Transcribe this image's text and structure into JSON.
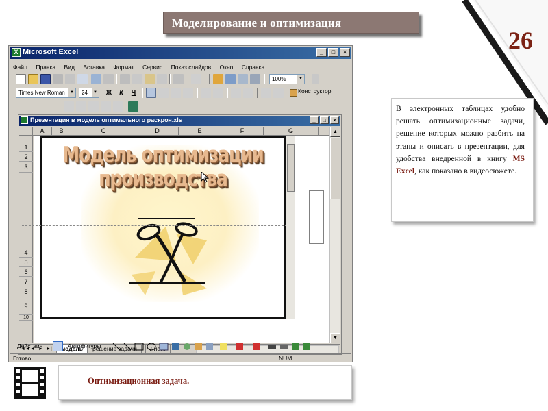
{
  "slide": {
    "title": "Моделирование и оптимизация",
    "number": "26",
    "description_before": "В электронных таблицах удобно решать оптимизационные задачи, решение которых можно разбить на этапы и описать в презентации, для удобства внедренной в книгу ",
    "description_highlight": "MS Excel",
    "description_after": ", как показано в видеосюжете.",
    "caption": "Оптимизационная задача.",
    "accent_color": "#7a1c12",
    "title_bg_color": "#8c7873"
  },
  "excel": {
    "window_title": "Microsoft Excel",
    "window_buttons": [
      "_",
      "□",
      "×"
    ],
    "menu": [
      "Файл",
      "Правка",
      "Вид",
      "Вставка",
      "Формат",
      "Сервис",
      "Показ слайдов",
      "Окно",
      "Справка"
    ],
    "zoom": "100%",
    "font_name": "Times New Roman",
    "font_size": "24",
    "bold_label": "Ж",
    "italic_label": "К",
    "underline_label": "Ч",
    "designer_label": "Конструктор",
    "workbook_title": "Презентация в модель оптимального раскроя.xls",
    "columns": [
      "A",
      "B",
      "C",
      "D",
      "E",
      "F",
      "G"
    ],
    "rows": [
      "1",
      "2",
      "3",
      "4",
      "5",
      "6",
      "7",
      "8",
      "9",
      "10"
    ],
    "embedded_slide": {
      "title_line1": "Модель оптимизации",
      "title_line2": "производства"
    },
    "sheet_nav": [
      "◄◄",
      "◄",
      "►",
      "►|"
    ],
    "sheet_tabs": [
      "модель",
      "решение задачи",
      "Лист3"
    ],
    "draw_actions": "Действия",
    "draw_autoshapes": "Автофигуры",
    "status": "Готово",
    "num_indicator": "NUM"
  }
}
